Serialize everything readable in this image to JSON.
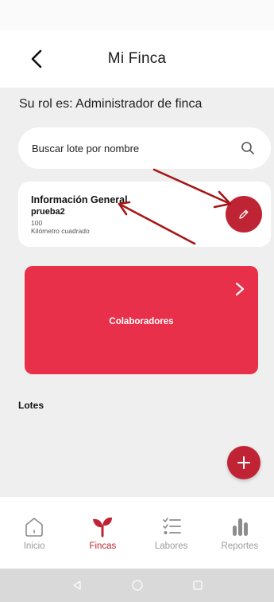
{
  "header": {
    "title": "Mi Finca"
  },
  "role": {
    "text": "Su rol es: Administrador de finca"
  },
  "search": {
    "placeholder": "Buscar lote por nombre"
  },
  "info_card": {
    "title": "Información General",
    "name": "prueba2",
    "area": "100",
    "unit": "Kilómetro cuadrado"
  },
  "collaborators": {
    "label": "Colaboradores"
  },
  "lotes": {
    "heading": "Lotes"
  },
  "bottom_nav": {
    "items": [
      {
        "label": "Inicio",
        "icon": "home-icon",
        "active": false
      },
      {
        "label": "Fincas",
        "icon": "sprout-icon",
        "active": true
      },
      {
        "label": "Labores",
        "icon": "checklist-icon",
        "active": false
      },
      {
        "label": "Reportes",
        "icon": "bar-chart-icon",
        "active": false
      }
    ]
  },
  "colors": {
    "primary": "#c02434",
    "card_red": "#e8304a",
    "background": "#efefef",
    "annotation_arrow": "#a61616",
    "inactive_nav": "#9b9b9b"
  }
}
